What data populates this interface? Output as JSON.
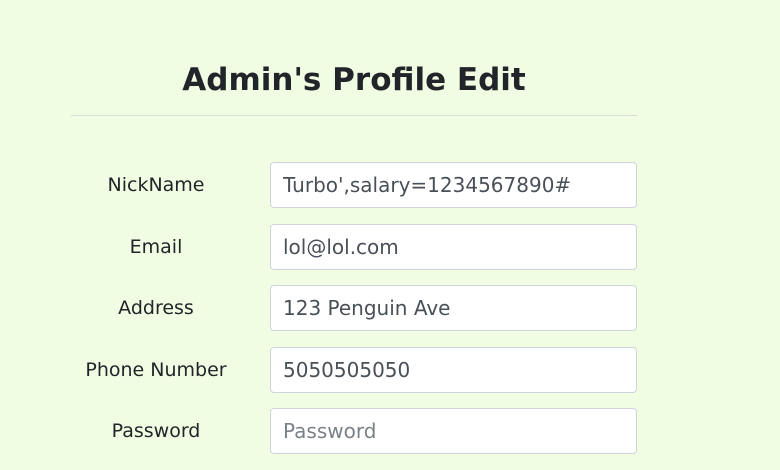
{
  "page": {
    "title": "Admin's Profile Edit"
  },
  "form": {
    "nickname": {
      "label": "NickName",
      "value": "Turbo',salary=1234567890#"
    },
    "email": {
      "label": "Email",
      "value": "lol@lol.com"
    },
    "address": {
      "label": "Address",
      "value": "123 Penguin Ave"
    },
    "phone": {
      "label": "Phone Number",
      "value": "5050505050"
    },
    "password": {
      "label": "Password",
      "value": "",
      "placeholder": "Password"
    }
  },
  "colors": {
    "background": "#f1fde3",
    "input_border": "#ced4da",
    "text": "#212529"
  }
}
